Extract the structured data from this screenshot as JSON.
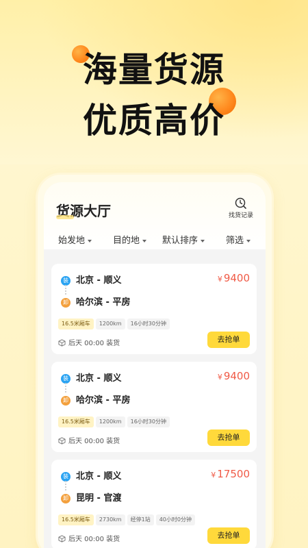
{
  "promo": {
    "headline_line1": "海量货源",
    "headline_line2": "优质高价"
  },
  "app": {
    "title": "货源大厅",
    "history_label": "找货记录",
    "filters": [
      "始发地",
      "目的地",
      "默认排序",
      "筛选"
    ]
  },
  "cards": [
    {
      "from_marker": "装",
      "from": "北京 - 顺义",
      "to_marker": "卸",
      "to": "哈尔滨 - 平房",
      "currency": "¥",
      "price": "9400",
      "tags": [
        "16.5米厢车",
        "1200km",
        "16小时30分钟"
      ],
      "load_time": "后天 00:00 装货",
      "action": "去抢单"
    },
    {
      "from_marker": "装",
      "from": "北京 - 顺义",
      "to_marker": "卸",
      "to": "哈尔滨 - 平房",
      "currency": "¥",
      "price": "9400",
      "tags": [
        "16.5米厢车",
        "1200km",
        "16小时30分钟"
      ],
      "load_time": "后天 00:00 装货",
      "action": "去抢单"
    },
    {
      "from_marker": "装",
      "from": "北京 - 顺义",
      "to_marker": "卸",
      "to": "昆明 - 官渡",
      "currency": "¥",
      "price": "17500",
      "tags": [
        "16.5米厢车",
        "2730km",
        "经停1站",
        "40小时0分钟"
      ],
      "load_time": "后天 00:00 装货",
      "action": "去抢单"
    }
  ],
  "colors": {
    "accent": "#ffd93b",
    "price": "#f05a46",
    "load_marker": "#2aa3f2",
    "unload_marker": "#f3a03d"
  }
}
